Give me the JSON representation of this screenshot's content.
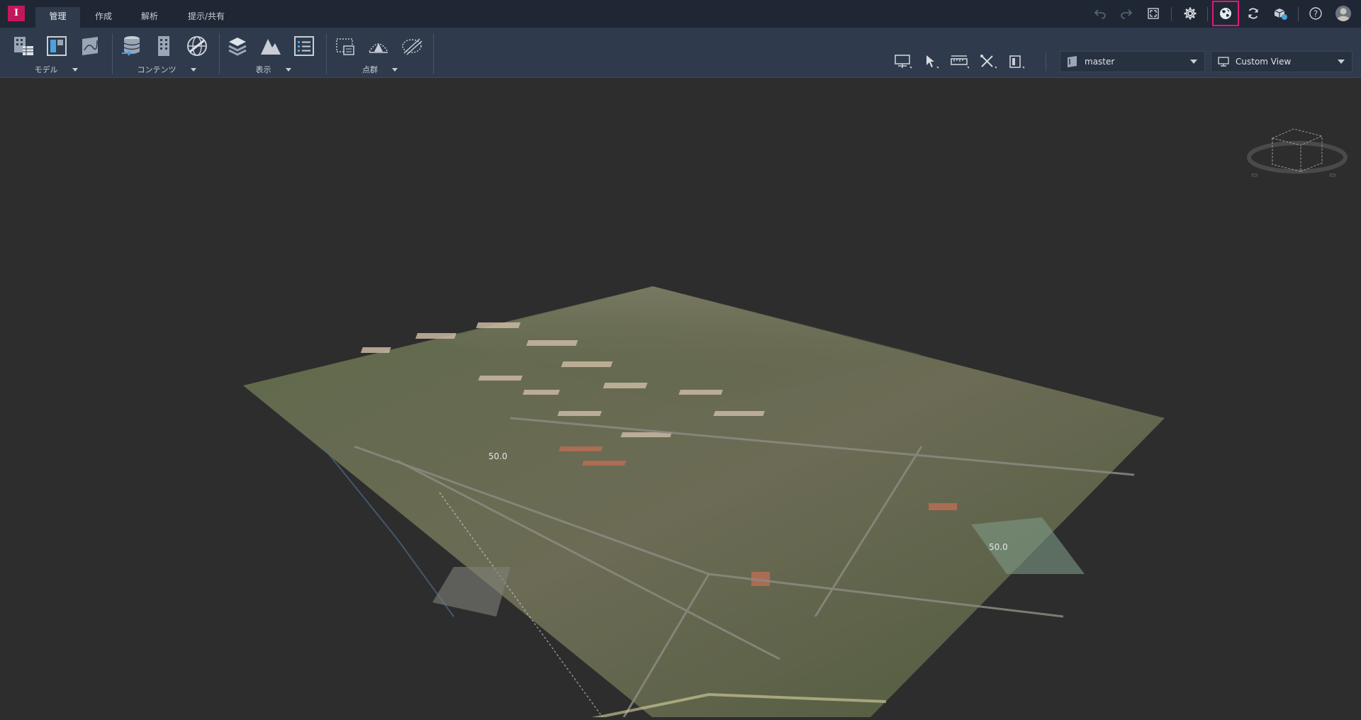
{
  "app": {
    "logo_letter": "I",
    "accent": "#c2185b"
  },
  "tabs": [
    {
      "label": "管理",
      "active": true
    },
    {
      "label": "作成",
      "active": false
    },
    {
      "label": "解析",
      "active": false
    },
    {
      "label": "提示/共有",
      "active": false
    }
  ],
  "quick_access": {
    "icons": [
      "undo-icon",
      "redo-icon",
      "fit-view-icon",
      "settings-icon",
      "globe-icon",
      "sync-icon",
      "cloud-model-icon",
      "help-icon",
      "avatar"
    ]
  },
  "ribbon": {
    "groups": [
      {
        "label": "モデル",
        "icons": [
          "building-table-icon",
          "model-panel-icon",
          "terrain-map-icon"
        ]
      },
      {
        "label": "コンテンツ",
        "icons": [
          "database-import-icon",
          "building-icon",
          "globe-network-icon"
        ]
      },
      {
        "label": "表示",
        "icons": [
          "layers-icon",
          "mountain-icon",
          "list-icon"
        ]
      },
      {
        "label": "点群",
        "icons": [
          "point-cloud-box-icon",
          "point-cloud-surface-icon",
          "point-cloud-slice-icon"
        ]
      }
    ]
  },
  "toolbar": {
    "tools": [
      "presentation-icon",
      "select-arrow-icon",
      "measure-icon",
      "sketch-tools-icon",
      "view-panel-icon"
    ],
    "proposal": {
      "value": "master",
      "icon": "proposal-icon"
    },
    "view": {
      "value": "Custom View",
      "icon": "view-monitor-icon"
    }
  },
  "scene": {
    "contour_labels": [
      "50.0",
      "50.0"
    ]
  }
}
